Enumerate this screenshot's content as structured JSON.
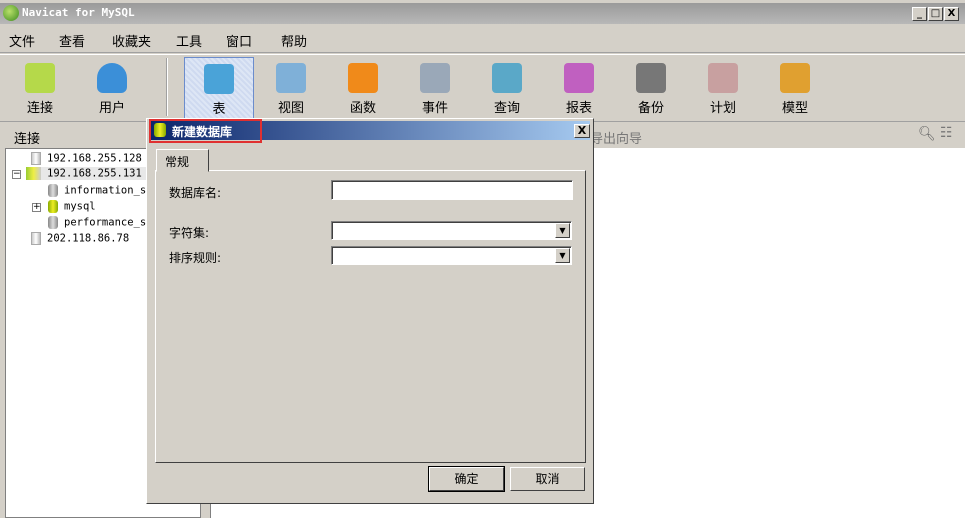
{
  "window": {
    "title": "Navicat for MySQL",
    "minimize": "_",
    "maximize": "□",
    "close": "X"
  },
  "menu": [
    "文件",
    "查看",
    "收藏夹",
    "工具",
    "窗口",
    "帮助"
  ],
  "toolbar": [
    {
      "label": "连接",
      "icon": "connection-icon",
      "color": "#b5d94a"
    },
    {
      "label": "用户",
      "icon": "user-icon",
      "color": "#3b8fd8"
    },
    {
      "label": "表",
      "icon": "table-icon",
      "color": "#4aa3d8"
    },
    {
      "label": "视图",
      "icon": "view-icon",
      "color": "#7fb0d8"
    },
    {
      "label": "函数",
      "icon": "function-icon",
      "color": "#f08a1a"
    },
    {
      "label": "事件",
      "icon": "event-icon",
      "color": "#9aa8b8"
    },
    {
      "label": "查询",
      "icon": "query-icon",
      "color": "#5aa8c8"
    },
    {
      "label": "报表",
      "icon": "report-icon",
      "color": "#c060c0"
    },
    {
      "label": "备份",
      "icon": "backup-icon",
      "color": "#777777"
    },
    {
      "label": "计划",
      "icon": "schedule-icon",
      "color": "#c8a0a0"
    },
    {
      "label": "模型",
      "icon": "model-icon",
      "color": "#e0a030"
    }
  ],
  "left_header": "连接",
  "tree": [
    "192.168.255.128",
    "192.168.255.131",
    "information_s",
    "mysql",
    "performance_s",
    "202.118.86.78"
  ],
  "right_header": "导出向导",
  "dialog": {
    "title": "新建数据库",
    "close": "X",
    "tab": "常规",
    "fields": {
      "name_label": "数据库名:",
      "name_value": "",
      "charset_label": "字符集:",
      "charset_value": "",
      "collation_label": "排序规则:",
      "collation_value": ""
    },
    "ok": "确定",
    "cancel": "取消"
  }
}
